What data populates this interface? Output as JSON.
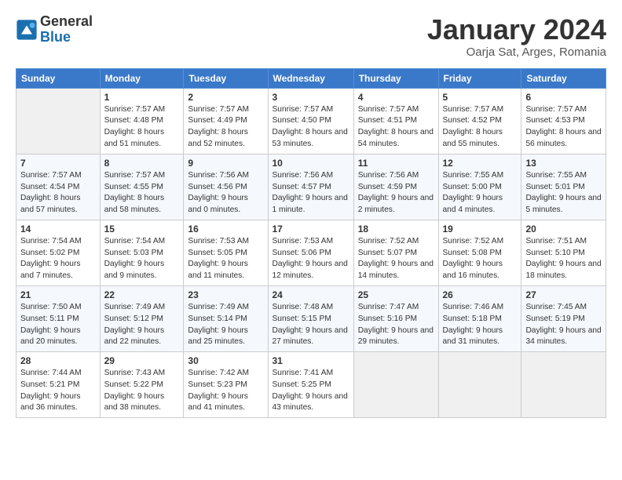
{
  "header": {
    "logo_text_general": "General",
    "logo_text_blue": "Blue",
    "title": "January 2024",
    "subtitle": "Oarja Sat, Arges, Romania"
  },
  "calendar": {
    "days_of_week": [
      "Sunday",
      "Monday",
      "Tuesday",
      "Wednesday",
      "Thursday",
      "Friday",
      "Saturday"
    ],
    "weeks": [
      [
        {
          "day": "",
          "info": ""
        },
        {
          "day": "1",
          "info": "Sunrise: 7:57 AM\nSunset: 4:48 PM\nDaylight: 8 hours and 51 minutes."
        },
        {
          "day": "2",
          "info": "Sunrise: 7:57 AM\nSunset: 4:49 PM\nDaylight: 8 hours and 52 minutes."
        },
        {
          "day": "3",
          "info": "Sunrise: 7:57 AM\nSunset: 4:50 PM\nDaylight: 8 hours and 53 minutes."
        },
        {
          "day": "4",
          "info": "Sunrise: 7:57 AM\nSunset: 4:51 PM\nDaylight: 8 hours and 54 minutes."
        },
        {
          "day": "5",
          "info": "Sunrise: 7:57 AM\nSunset: 4:52 PM\nDaylight: 8 hours and 55 minutes."
        },
        {
          "day": "6",
          "info": "Sunrise: 7:57 AM\nSunset: 4:53 PM\nDaylight: 8 hours and 56 minutes."
        }
      ],
      [
        {
          "day": "7",
          "info": "Sunrise: 7:57 AM\nSunset: 4:54 PM\nDaylight: 8 hours and 57 minutes."
        },
        {
          "day": "8",
          "info": "Sunrise: 7:57 AM\nSunset: 4:55 PM\nDaylight: 8 hours and 58 minutes."
        },
        {
          "day": "9",
          "info": "Sunrise: 7:56 AM\nSunset: 4:56 PM\nDaylight: 9 hours and 0 minutes."
        },
        {
          "day": "10",
          "info": "Sunrise: 7:56 AM\nSunset: 4:57 PM\nDaylight: 9 hours and 1 minute."
        },
        {
          "day": "11",
          "info": "Sunrise: 7:56 AM\nSunset: 4:59 PM\nDaylight: 9 hours and 2 minutes."
        },
        {
          "day": "12",
          "info": "Sunrise: 7:55 AM\nSunset: 5:00 PM\nDaylight: 9 hours and 4 minutes."
        },
        {
          "day": "13",
          "info": "Sunrise: 7:55 AM\nSunset: 5:01 PM\nDaylight: 9 hours and 5 minutes."
        }
      ],
      [
        {
          "day": "14",
          "info": "Sunrise: 7:54 AM\nSunset: 5:02 PM\nDaylight: 9 hours and 7 minutes."
        },
        {
          "day": "15",
          "info": "Sunrise: 7:54 AM\nSunset: 5:03 PM\nDaylight: 9 hours and 9 minutes."
        },
        {
          "day": "16",
          "info": "Sunrise: 7:53 AM\nSunset: 5:05 PM\nDaylight: 9 hours and 11 minutes."
        },
        {
          "day": "17",
          "info": "Sunrise: 7:53 AM\nSunset: 5:06 PM\nDaylight: 9 hours and 12 minutes."
        },
        {
          "day": "18",
          "info": "Sunrise: 7:52 AM\nSunset: 5:07 PM\nDaylight: 9 hours and 14 minutes."
        },
        {
          "day": "19",
          "info": "Sunrise: 7:52 AM\nSunset: 5:08 PM\nDaylight: 9 hours and 16 minutes."
        },
        {
          "day": "20",
          "info": "Sunrise: 7:51 AM\nSunset: 5:10 PM\nDaylight: 9 hours and 18 minutes."
        }
      ],
      [
        {
          "day": "21",
          "info": "Sunrise: 7:50 AM\nSunset: 5:11 PM\nDaylight: 9 hours and 20 minutes."
        },
        {
          "day": "22",
          "info": "Sunrise: 7:49 AM\nSunset: 5:12 PM\nDaylight: 9 hours and 22 minutes."
        },
        {
          "day": "23",
          "info": "Sunrise: 7:49 AM\nSunset: 5:14 PM\nDaylight: 9 hours and 25 minutes."
        },
        {
          "day": "24",
          "info": "Sunrise: 7:48 AM\nSunset: 5:15 PM\nDaylight: 9 hours and 27 minutes."
        },
        {
          "day": "25",
          "info": "Sunrise: 7:47 AM\nSunset: 5:16 PM\nDaylight: 9 hours and 29 minutes."
        },
        {
          "day": "26",
          "info": "Sunrise: 7:46 AM\nSunset: 5:18 PM\nDaylight: 9 hours and 31 minutes."
        },
        {
          "day": "27",
          "info": "Sunrise: 7:45 AM\nSunset: 5:19 PM\nDaylight: 9 hours and 34 minutes."
        }
      ],
      [
        {
          "day": "28",
          "info": "Sunrise: 7:44 AM\nSunset: 5:21 PM\nDaylight: 9 hours and 36 minutes."
        },
        {
          "day": "29",
          "info": "Sunrise: 7:43 AM\nSunset: 5:22 PM\nDaylight: 9 hours and 38 minutes."
        },
        {
          "day": "30",
          "info": "Sunrise: 7:42 AM\nSunset: 5:23 PM\nDaylight: 9 hours and 41 minutes."
        },
        {
          "day": "31",
          "info": "Sunrise: 7:41 AM\nSunset: 5:25 PM\nDaylight: 9 hours and 43 minutes."
        },
        {
          "day": "",
          "info": ""
        },
        {
          "day": "",
          "info": ""
        },
        {
          "day": "",
          "info": ""
        }
      ]
    ]
  }
}
